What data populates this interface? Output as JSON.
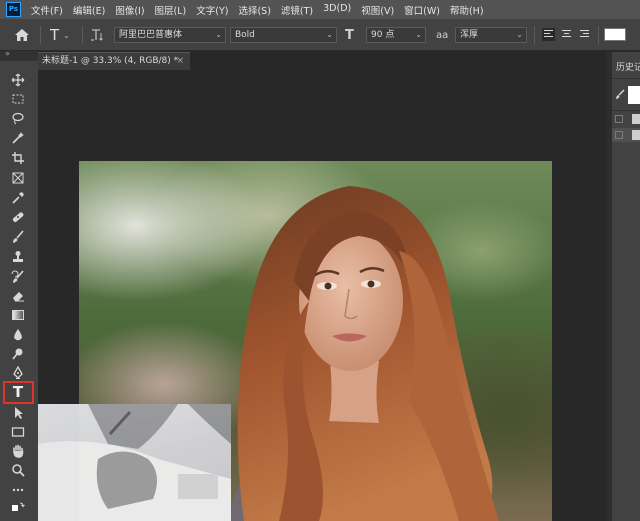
{
  "app": {
    "logo_text": "Ps"
  },
  "menu": [
    "文件(F)",
    "编辑(E)",
    "图像(I)",
    "图层(L)",
    "文字(Y)",
    "选择(S)",
    "滤镜(T)",
    "3D(D)",
    "视图(V)",
    "窗口(W)",
    "帮助(H)"
  ],
  "options_bar": {
    "home_icon": "home-icon",
    "type_tool_glyph": "T",
    "font_family": "阿里巴巴普惠体",
    "font_style": "Bold",
    "size_icon_glyph": "T",
    "font_size": "90 点",
    "antialias_glyph": "aa",
    "antialias": "浑厚",
    "text_color": "#ffffff"
  },
  "document": {
    "tab_title": "未标题-1 @ 33.3% (4, RGB/8) *",
    "close_glyph": "×"
  },
  "toolbar": {
    "collapse_glyph": "»",
    "active_tool": "type-tool",
    "highlight_color": "#e0342b",
    "tools": [
      "move",
      "marquee",
      "lasso",
      "quick-selection",
      "crop",
      "frame",
      "eyedropper",
      "healing-brush",
      "brush",
      "clone-stamp",
      "history-brush",
      "eraser",
      "gradient",
      "blur",
      "dodge",
      "pen",
      "type",
      "path-selection",
      "rectangle",
      "hand",
      "zoom",
      "edit-toolbar",
      "foreground-background"
    ]
  },
  "right_panel": {
    "history_title": "历史记"
  }
}
